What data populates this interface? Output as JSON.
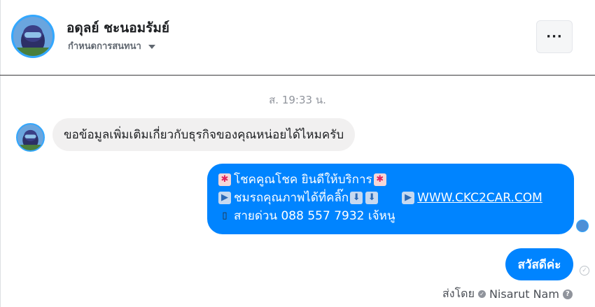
{
  "header": {
    "name": "อดุลย์ ชะนอมรัมย์",
    "subtitle": "กำหนดการสนทนา",
    "more_label": "···"
  },
  "timestamp": "ส. 19:33 น.",
  "incoming": {
    "text": "ขอข้อมูลเพิ่มเติมเกี่ยวกับธุรกิจของคุณหน่อยได้ไหมครับ"
  },
  "outgoing_card": {
    "line1": "โชคคูณโชค ยินดีให้บริการ",
    "line2_text": "ชมรถคุณภาพได้ที่คลิ๊ก",
    "line2_link": "WWW.CKC2CAR.COM",
    "line3": "สายด่วน 088 557 7932 เจ้หนู"
  },
  "outgoing_small": {
    "text": "สวัสดีค่ะ"
  },
  "sent_by": {
    "label": "ส่งโดย",
    "name": "Nisarut Nam"
  },
  "icons": {
    "anger": "anger-symbol-icon",
    "play": "play-button-icon",
    "down": "down-arrow-icon",
    "phone": "mobile-phone-icon",
    "help": "question-mark-icon"
  },
  "colors": {
    "outgoing_bubble": "#0084ff",
    "incoming_bubble": "#f1f0f0",
    "avatar_ring": "#33a8ff"
  }
}
